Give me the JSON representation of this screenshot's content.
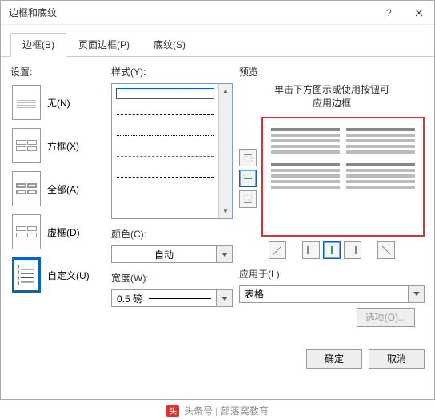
{
  "window": {
    "title": "边框和底纹"
  },
  "tabs": [
    {
      "label": "边框(B)",
      "active": true
    },
    {
      "label": "页面边框(P)",
      "active": false
    },
    {
      "label": "底纹(S)",
      "active": false
    }
  ],
  "settings": {
    "heading": "设置:",
    "items": [
      {
        "key": "none",
        "label": "无(N)"
      },
      {
        "key": "box",
        "label": "方框(X)"
      },
      {
        "key": "all",
        "label": "全部(A)"
      },
      {
        "key": "grid",
        "label": "虚框(D)"
      },
      {
        "key": "custom",
        "label": "自定义(U)",
        "selected": true
      }
    ]
  },
  "style": {
    "heading": "样式(Y):",
    "options": [
      "solid",
      "dashed",
      "dotted",
      "dashdot",
      "dashspace"
    ]
  },
  "color": {
    "heading": "颜色(C):",
    "value": "自动"
  },
  "width": {
    "heading": "宽度(W):",
    "value": "0.5 磅"
  },
  "preview": {
    "heading": "预览",
    "hint_line1": "单击下方图示或使用按钮可",
    "hint_line2": "应用边框"
  },
  "apply": {
    "heading": "应用于(L):",
    "value": "表格"
  },
  "buttons": {
    "options": "选项(O)...",
    "ok": "确定",
    "cancel": "取消"
  },
  "watermark": "头条号 | 部落窝教育"
}
